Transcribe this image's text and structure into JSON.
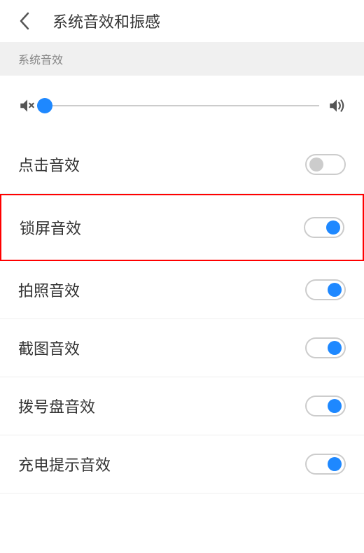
{
  "header": {
    "title": "系统音效和振感"
  },
  "section": {
    "label": "系统音效"
  },
  "slider": {
    "value": 0
  },
  "settings": [
    {
      "label": "点击音效",
      "enabled": false,
      "highlighted": false
    },
    {
      "label": "锁屏音效",
      "enabled": true,
      "highlighted": true
    },
    {
      "label": "拍照音效",
      "enabled": true,
      "highlighted": false
    },
    {
      "label": "截图音效",
      "enabled": true,
      "highlighted": false
    },
    {
      "label": "拨号盘音效",
      "enabled": true,
      "highlighted": false
    },
    {
      "label": "充电提示音效",
      "enabled": true,
      "highlighted": false
    }
  ]
}
